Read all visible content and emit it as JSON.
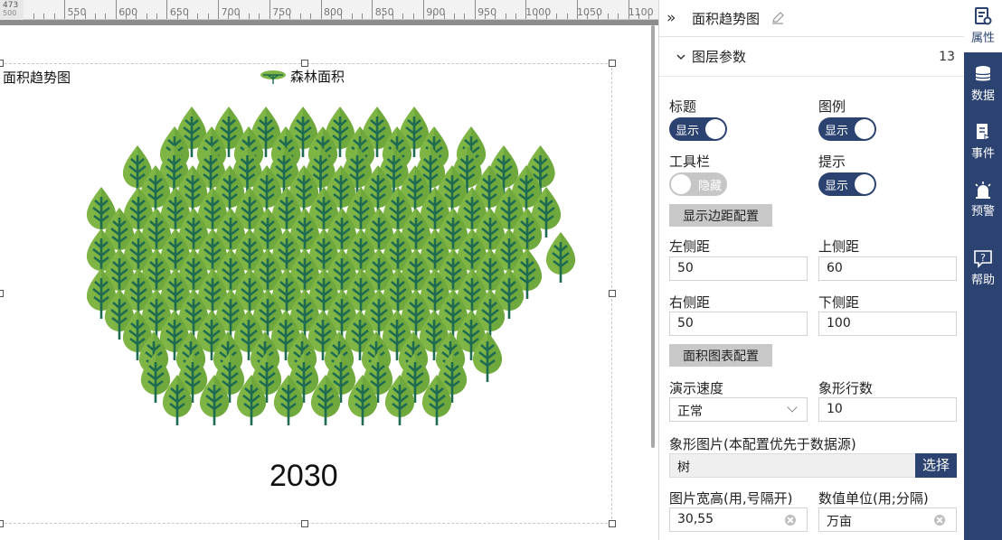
{
  "ruler": {
    "corner_top": "473",
    "corner_bottom": "500",
    "labels": [
      "550",
      "600",
      "650",
      "700",
      "750",
      "800",
      "850",
      "900",
      "950",
      "1000",
      "1050",
      "1100"
    ]
  },
  "chart": {
    "title": "面积趋势图",
    "legend_label": "森林面积",
    "year": "2030",
    "tree_colors": {
      "leaf_light": "#7fb545",
      "leaf_dark": "#5e9a34",
      "trunk": "#1f6b52"
    }
  },
  "panel": {
    "title": "面积趋势图",
    "section_title": "图层参数",
    "section_count": "13",
    "fields": {
      "title_label": "标题",
      "title_toggle": "显示",
      "legend_label": "图例",
      "legend_toggle": "显示",
      "toolbar_label": "工具栏",
      "toolbar_toggle": "隐藏",
      "tooltip_label": "提示",
      "tooltip_toggle": "显示",
      "margin_config_button": "显示边距配置",
      "left_margin_label": "左侧距",
      "left_margin_value": "50",
      "top_margin_label": "上侧距",
      "top_margin_value": "60",
      "right_margin_label": "右侧距",
      "right_margin_value": "50",
      "bottom_margin_label": "下侧距",
      "bottom_margin_value": "100",
      "area_config_button": "面积图表配置",
      "speed_label": "演示速度",
      "speed_value": "正常",
      "rows_label": "象形行数",
      "rows_value": "10",
      "image_label": "象形图片(本配置优先于数据源)",
      "image_value": "树",
      "image_button": "选择",
      "size_label": "图片宽高(用,号隔开)",
      "size_value": "30,55",
      "unit_label": "数值单位(用;分隔)",
      "unit_value": "万亩"
    }
  },
  "rail": {
    "items": [
      {
        "label": "属性",
        "icon": "properties-icon",
        "active": true
      },
      {
        "label": "数据",
        "icon": "database-icon",
        "active": false
      },
      {
        "label": "事件",
        "icon": "event-icon",
        "active": false
      },
      {
        "label": "预警",
        "icon": "alarm-icon",
        "active": false
      },
      {
        "label": "帮助",
        "icon": "help-icon",
        "active": false
      }
    ]
  },
  "colors": {
    "accent": "#2c4372",
    "toggle_off": "#c6c6c6"
  }
}
